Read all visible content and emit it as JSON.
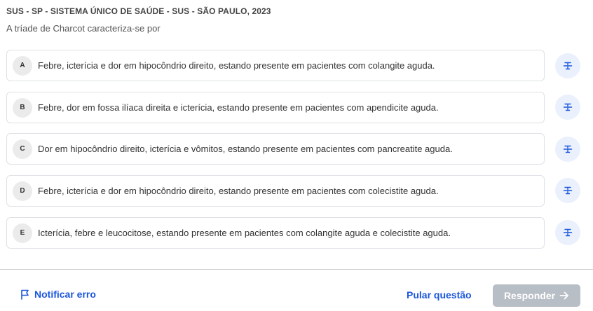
{
  "question": {
    "source": "SUS - SP - SISTEMA ÚNICO DE SAÚDE - SUS - SÃO PAULO, 2023",
    "statement": "A tríade de Charcot caracteriza-se por"
  },
  "options": [
    {
      "letter": "A",
      "text": "Febre, icterícia e dor em hipocôndrio direito, estando presente em pacientes com colangite aguda."
    },
    {
      "letter": "B",
      "text": "Febre, dor em fossa ilíaca direita e icterícia, estando presente em pacientes com apendicite aguda."
    },
    {
      "letter": "C",
      "text": "Dor em hipocôndrio direito, icterícia e vômitos, estando presente em pacientes com pancreatite aguda."
    },
    {
      "letter": "D",
      "text": "Febre, icterícia e dor em hipocôndrio direito, estando presente em pacientes com colecistite aguda."
    },
    {
      "letter": "E",
      "text": "Icterícia, febre e leucocitose, estando presente em pacientes com colangite aguda e colecistite aguda."
    }
  ],
  "footer": {
    "report_label": "Notificar erro",
    "skip_label": "Pular questão",
    "answer_label": "Responder"
  },
  "icons": {
    "strike": "strikethrough-icon",
    "flag": "flag-icon",
    "arrow": "arrow-right-icon"
  },
  "colors": {
    "accent": "#1a56db",
    "disabled_button": "#b8bec5",
    "strike_button_bg": "#eaf0fc"
  }
}
